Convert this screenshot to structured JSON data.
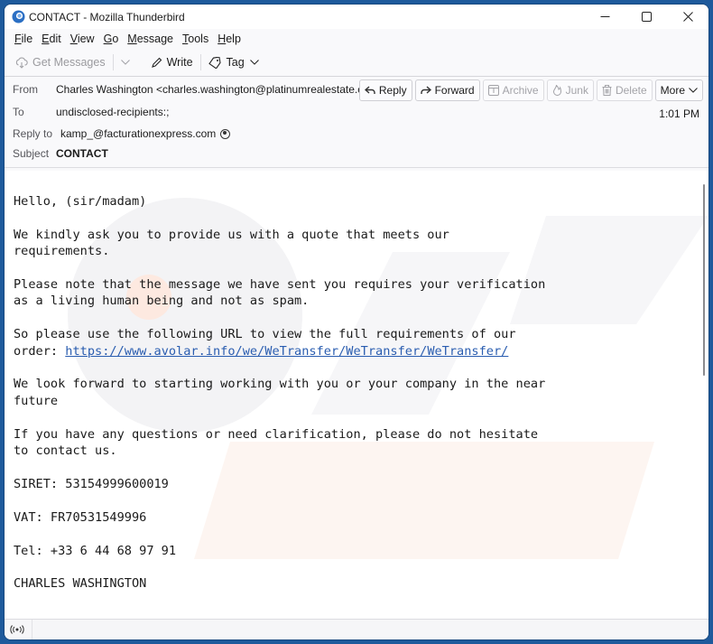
{
  "window": {
    "title": "CONTACT - Mozilla Thunderbird",
    "controls": {
      "minimize": "—",
      "maximize": "☐",
      "close": "✕"
    }
  },
  "menubar": {
    "items": [
      {
        "label": "File",
        "mnemonic": "F",
        "rest": "ile"
      },
      {
        "label": "Edit",
        "mnemonic": "E",
        "rest": "dit"
      },
      {
        "label": "View",
        "mnemonic": "V",
        "rest": "iew"
      },
      {
        "label": "Go",
        "mnemonic": "G",
        "rest": "o"
      },
      {
        "label": "Message",
        "mnemonic": "M",
        "rest": "essage"
      },
      {
        "label": "Tools",
        "mnemonic": "T",
        "rest": "ools"
      },
      {
        "label": "Help",
        "mnemonic": "H",
        "rest": "elp"
      }
    ]
  },
  "toolbar": {
    "get_messages": "Get Messages",
    "write": "Write",
    "tag": "Tag"
  },
  "header": {
    "from_label": "From",
    "from_value": "Charles Washington <charles.washington@platinumrealestate.com>",
    "to_label": "To",
    "to_value": "undisclosed-recipients:;",
    "reply_to_label": "Reply to",
    "reply_to_value": "kamp_@facturationexpress.com",
    "subject_label": "Subject",
    "subject_value": "CONTACT",
    "time": "1:01 PM",
    "actions": {
      "reply": "Reply",
      "forward": "Forward",
      "archive": "Archive",
      "junk": "Junk",
      "delete": "Delete",
      "more": "More"
    }
  },
  "message": {
    "greeting": "Hello, (sir/madam)",
    "para1": "We kindly ask you to provide us with a quote that meets our\nrequirements.",
    "para2": "Please note that the message we have sent you requires your verification\nas a living human being and not as spam.",
    "para3_prefix": "So please use the following URL to view the full requirements of our\norder: ",
    "link": "https://www.avolar.info/we/WeTransfer/WeTransfer/WeTransfer/",
    "para4": "We look forward to starting working with you or your company in the near\nfuture",
    "para5": "If you have any questions or need clarification, please do not hesitate\nto contact us.",
    "siret": "SIRET: 53154999600019",
    "vat": "VAT: FR70531549996",
    "tel": "Tel: +33 6 44 68 97 91",
    "signature": "CHARLES WASHINGTON"
  },
  "statusbar": {
    "icon": "activity-icon"
  },
  "colors": {
    "desktop": "#1e5a9c",
    "link": "#2a5db0",
    "app_icon": "#2b6fc4"
  }
}
